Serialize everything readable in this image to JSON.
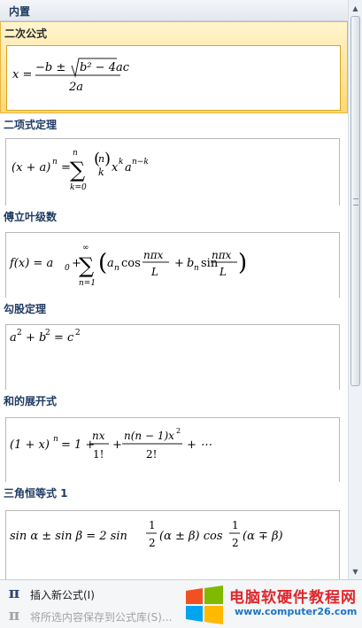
{
  "gallery": {
    "header": "内置",
    "items": [
      {
        "title": "二次公式",
        "selected": true
      },
      {
        "title": "二项式定理"
      },
      {
        "title": "傅立叶级数"
      },
      {
        "title": "勾股定理"
      },
      {
        "title": "和的展开式"
      },
      {
        "title": "三角恒等式 1"
      }
    ],
    "formulas": {
      "quadratic": {
        "lhs": "x =",
        "num": "−b ± ",
        "radicand": "b² − 4ac",
        "den": "2a"
      },
      "binomial": {
        "lhs": "(x + a)",
        "lhs_exp": "n",
        "eq": "=",
        "sum": "∑",
        "upper": "n",
        "lower": "k=0",
        "binom_top": "n",
        "binom_bottom": "k",
        "term": "x",
        "term_exp": "k",
        "term2": "a",
        "term2_exp": "n−k"
      },
      "fourier": {
        "lhs": "f(x) = a",
        "lhs_sub": "0",
        "plus": "+",
        "sum": "∑",
        "upper": "∞",
        "lower": "n=1",
        "a": "a",
        "a_sub": "n",
        "cos": "cos",
        "num1": "nπx",
        "den1": "L",
        "plus2": "+",
        "b": "b",
        "b_sub": "n",
        "sin": "sin",
        "num2": "nπx",
        "den2": "L"
      },
      "pythagorean": {
        "a": "a",
        "a_exp": "2",
        "plus": "+ b",
        "b_exp": "2",
        "eq": "= c",
        "c_exp": "2"
      },
      "expansion": {
        "lhs": "(1 + x)",
        "lhs_exp": "n",
        "eq": "= 1 +",
        "num1": "nx",
        "den1": "1!",
        "plus": "+",
        "num2": "n(n − 1)x",
        "num2_exp": "2",
        "den2": "2!",
        "tail": "+ ⋯"
      },
      "trig": {
        "lhs": "sin α ± sin β = 2 sin",
        "num1": "1",
        "den1": "2",
        "mid": "(α ± β) cos",
        "num2": "1",
        "den2": "2",
        "tail": "(α ∓ β)"
      }
    }
  },
  "footer": {
    "insert_icon": "pi-icon",
    "insert_symbol": "π",
    "insert_label": "插入新公式(I)",
    "save_icon": "pi-save-icon",
    "save_symbol": "π",
    "save_label": "将所选内容保存到公式库(S)..."
  },
  "watermark": {
    "title": "电脑软硬件教程网",
    "url": "www.computer26.com",
    "colors": [
      "#f25022",
      "#7fba00",
      "#00a4ef",
      "#ffb900"
    ]
  }
}
